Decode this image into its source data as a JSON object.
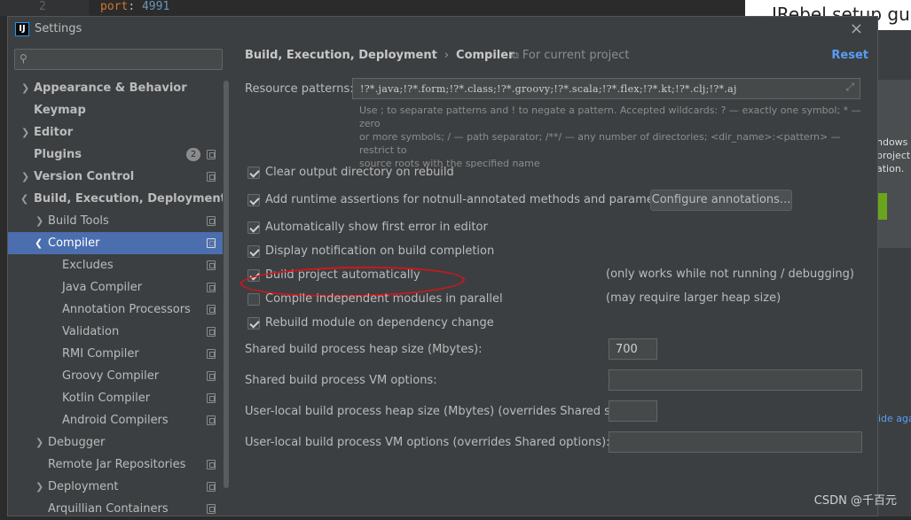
{
  "background": {
    "editor_line_number": "2",
    "editor_key": "port",
    "editor_value": "4991",
    "right_top_text": "JRebel setup gui",
    "right_panel_lines": [
      "ndows",
      "project",
      "ation."
    ],
    "right_link_text": "ide aga",
    "watermark": "CSDN @千百元"
  },
  "dialog": {
    "title": "Settings",
    "app_icon_text": "IJ",
    "close_symbol": "×"
  },
  "sidebar": {
    "search_placeholder": "",
    "items": [
      {
        "label": "Appearance & Behavior"
      },
      {
        "label": "Keymap"
      },
      {
        "label": "Editor"
      },
      {
        "label": "Plugins",
        "badge": "2"
      },
      {
        "label": "Version Control"
      },
      {
        "label": "Build, Execution, Deployment"
      },
      {
        "label": "Build Tools"
      },
      {
        "label": "Compiler"
      },
      {
        "label": "Excludes"
      },
      {
        "label": "Java Compiler"
      },
      {
        "label": "Annotation Processors"
      },
      {
        "label": "Validation"
      },
      {
        "label": "RMI Compiler"
      },
      {
        "label": "Groovy Compiler"
      },
      {
        "label": "Kotlin Compiler"
      },
      {
        "label": "Android Compilers"
      },
      {
        "label": "Debugger"
      },
      {
        "label": "Remote Jar Repositories"
      },
      {
        "label": "Deployment"
      },
      {
        "label": "Arquillian Containers"
      }
    ]
  },
  "main": {
    "breadcrumb": [
      "Build, Execution, Deployment",
      "Compiler"
    ],
    "breadcrumb_sep": "›",
    "for_project": "For current project",
    "reset": "Reset",
    "resource_patterns_label": "Resource patterns:",
    "resource_patterns_value": "!?*.java;!?*.form;!?*.class;!?*.groovy;!?*.scala;!?*.flex;!?*.kt;!?*.clj;!?*.aj",
    "hint_line1": "Use ; to separate patterns and ! to negate a pattern. Accepted wildcards: ? — exactly one symbol; * — zero",
    "hint_line2": "or more symbols; / — path separator; /**/ — any number of directories; <dir_name>:<pattern> — restrict to",
    "hint_line3": "source roots with the specified name",
    "options": [
      {
        "label": "Clear output directory on rebuild",
        "checked": true
      },
      {
        "label": "Add runtime assertions for notnull-annotated methods and parameters",
        "checked": true
      },
      {
        "label": "Automatically show first error in editor",
        "checked": true
      },
      {
        "label": "Display notification on build completion",
        "checked": true
      },
      {
        "label": "Build project automatically",
        "checked": true
      },
      {
        "label": "Compile independent modules in parallel",
        "checked": false
      },
      {
        "label": "Rebuild module on dependency change",
        "checked": true
      }
    ],
    "configure_button": "Configure annotations...",
    "note_build_auto": "(only works while not running / debugging)",
    "note_parallel": "(may require larger heap size)",
    "heap_label": "Shared build process heap size (Mbytes):",
    "heap_value": "700",
    "vm_label": "Shared build process VM options:",
    "vm_value": "",
    "user_heap_label": "User-local build process heap size (Mbytes) (overrides Shared size):",
    "user_heap_value": "",
    "user_vm_label": "User-local build process VM options (overrides Shared options):",
    "user_vm_value": "",
    "annotation_color": "#d0161b"
  }
}
